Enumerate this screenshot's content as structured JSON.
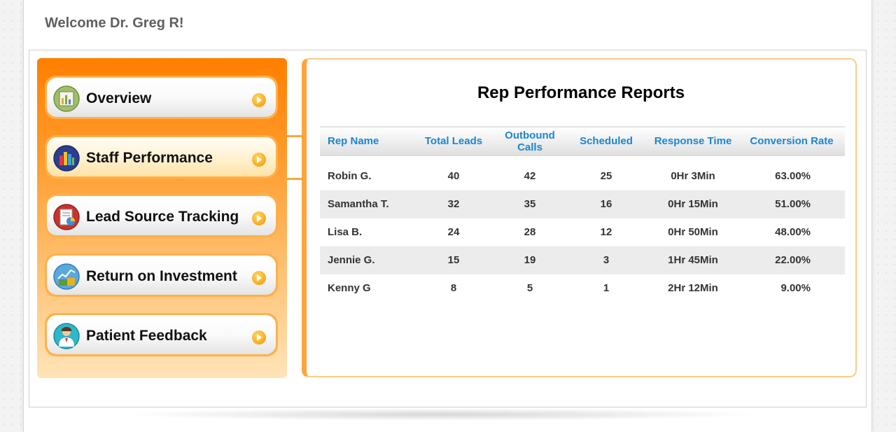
{
  "header": {
    "welcome": "Welcome Dr. Greg R!"
  },
  "colors": {
    "accent_orange": "#ff7f00",
    "header_blue": "#1a86d2"
  },
  "sidebar": {
    "items": [
      {
        "label": "Overview",
        "icon": "overview-icon",
        "active": false
      },
      {
        "label": "Staff Performance",
        "icon": "bar-chart-icon",
        "active": true
      },
      {
        "label": "Lead Source Tracking",
        "icon": "pie-report-icon",
        "active": false
      },
      {
        "label": "Return on Investment",
        "icon": "money-chart-icon",
        "active": false
      },
      {
        "label": "Patient Feedback",
        "icon": "doctor-icon",
        "active": false
      }
    ]
  },
  "report": {
    "title": "Rep Performance Reports",
    "columns": [
      "Rep Name",
      "Total Leads",
      "Outbound Calls",
      "Scheduled",
      "Response Time",
      "Conversion Rate"
    ],
    "rows": [
      [
        "Robin G.",
        "40",
        "42",
        "25",
        "0Hr 3Min",
        "63.00%"
      ],
      [
        "Samantha T.",
        "32",
        "35",
        "16",
        "0Hr 15Min",
        "51.00%"
      ],
      [
        "Lisa B.",
        "24",
        "28",
        "12",
        "0Hr 50Min",
        "48.00%"
      ],
      [
        "Jennie G.",
        "15",
        "19",
        "3",
        "1Hr 45Min",
        "22.00%"
      ],
      [
        "Kenny G",
        "8",
        "5",
        "1",
        "2Hr 12Min",
        "9.00%"
      ]
    ]
  }
}
